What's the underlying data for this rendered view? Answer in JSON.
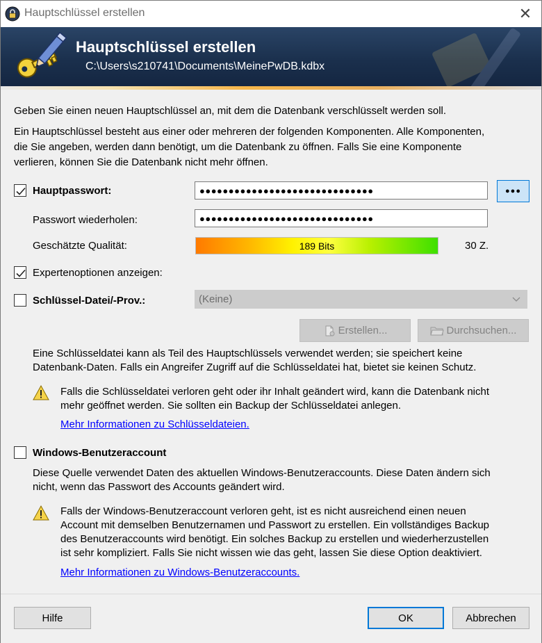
{
  "window": {
    "title": "Hauptschlüssel erstellen",
    "close_symbol": "✕"
  },
  "banner": {
    "title": "Hauptschlüssel erstellen",
    "path": "C:\\Users\\s210741\\Documents\\MeinePwDB.kdbx",
    "icon": "key-pencil-icon"
  },
  "intro": {
    "line1": "Geben Sie einen neuen Hauptschlüssel an, mit dem die Datenbank verschlüsselt werden soll.",
    "line2a": "Ein Hauptschlüssel besteht aus einer oder mehreren der folgenden Komponenten. Alle Komponenten,",
    "line2b": "die Sie angeben, werden dann benötigt, um die Datenbank zu öffnen. Falls Sie eine Komponente",
    "line2c": "verlieren, können Sie die Datenbank nicht mehr öffnen."
  },
  "password": {
    "checked": true,
    "label": "Hauptpasswort:",
    "value": "●●●●●●●●●●●●●●●●●●●●●●●●●●●●●●",
    "toggle_label": "●●●",
    "repeat_label": "Passwort wiederholen:",
    "repeat_value": "●●●●●●●●●●●●●●●●●●●●●●●●●●●●●●",
    "quality_label": "Geschätzte Qualität:",
    "quality_text": "189 Bits",
    "quality_fraction": 1.0,
    "length_text": "30 Z."
  },
  "expert": {
    "checked": true,
    "label": "Expertenoptionen anzeigen:"
  },
  "keyfile": {
    "checked": false,
    "label": "Schlüssel-Datei/-Prov.:",
    "selected": "(Keine)",
    "create_label": "Erstellen...",
    "browse_label": "Durchsuchen...",
    "desc_a": "Eine Schlüsseldatei kann als Teil des Hauptschlüssels verwendet werden; sie speichert keine",
    "desc_b": "Datenbank-Daten. Falls ein Angreifer Zugriff auf die Schlüsseldatei hat, bietet sie keinen Schutz.",
    "warn_a": "Falls die Schlüsseldatei verloren geht oder ihr Inhalt geändert wird, kann die Datenbank nicht",
    "warn_b": "mehr geöffnet werden. Sie sollten ein Backup der Schlüsseldatei anlegen.",
    "link": "Mehr Informationen zu Schlüsseldateien."
  },
  "winaccount": {
    "checked": false,
    "label": "Windows-Benutzeraccount",
    "desc_a": "Diese Quelle verwendet Daten des aktuellen Windows-Benutzeraccounts. Diese Daten ändern sich",
    "desc_b": "nicht, wenn das Passwort des Accounts geändert wird.",
    "warn_a": "Falls der Windows-Benutzeraccount verloren geht, ist es nicht ausreichend einen neuen",
    "warn_b": "Account mit demselben Benutzernamen und Passwort zu erstellen. Ein vollständiges Backup",
    "warn_c": "des Benutzeraccounts wird benötigt. Ein solches Backup zu erstellen und wiederherzustellen",
    "warn_d": "ist sehr kompliziert. Falls Sie nicht wissen wie das geht, lassen Sie diese Option deaktiviert.",
    "link": "Mehr Informationen zu Windows-Benutzeraccounts."
  },
  "footer": {
    "help": "Hilfe",
    "ok": "OK",
    "cancel": "Abbrechen"
  },
  "colors": {
    "banner": "#1f3656",
    "accent": "#0078d7",
    "link": "#0000ff"
  }
}
